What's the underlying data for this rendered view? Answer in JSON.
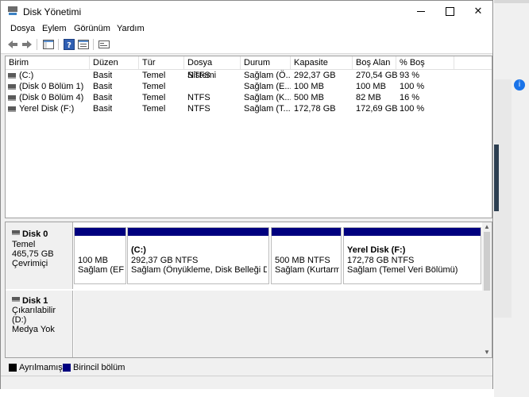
{
  "window": {
    "title": "Disk Yönetimi"
  },
  "menu": [
    "Dosya",
    "Eylem",
    "Görünüm",
    "Yardım"
  ],
  "volume_table": {
    "columns": [
      "Birim",
      "Düzen",
      "Tür",
      "Dosya Sistemi",
      "Durum",
      "Kapasite",
      "Boş Alan",
      "% Boş"
    ],
    "rows": [
      {
        "birim": "(C:)",
        "duzen": "Basit",
        "tur": "Temel",
        "fs": "NTFS",
        "durum": "Sağlam (Ö...",
        "kapasite": "292,37 GB",
        "bos": "270,54 GB",
        "yuzde": "93 %"
      },
      {
        "birim": "(Disk 0 Bölüm 1)",
        "duzen": "Basit",
        "tur": "Temel",
        "fs": "",
        "durum": "Sağlam (E...",
        "kapasite": "100 MB",
        "bos": "100 MB",
        "yuzde": "100 %"
      },
      {
        "birim": "(Disk 0 Bölüm 4)",
        "duzen": "Basit",
        "tur": "Temel",
        "fs": "NTFS",
        "durum": "Sağlam (K...",
        "kapasite": "500 MB",
        "bos": "82 MB",
        "yuzde": "16 %"
      },
      {
        "birim": "Yerel Disk (F:)",
        "duzen": "Basit",
        "tur": "Temel",
        "fs": "NTFS",
        "durum": "Sağlam (T...",
        "kapasite": "172,78 GB",
        "bos": "172,69 GB",
        "yuzde": "100 %"
      }
    ]
  },
  "disks": [
    {
      "name": "Disk 0",
      "lines": [
        "Temel",
        "465,75 GB",
        "Çevrimiçi"
      ],
      "partitions": [
        {
          "title": "",
          "size": "100 MB",
          "status": "Sağlam (EFI"
        },
        {
          "title": "(C:)",
          "size": "292,37 GB NTFS",
          "status": "Sağlam (Önyükleme, Disk Belleği Dosya"
        },
        {
          "title": "",
          "size": "500 MB NTFS",
          "status": "Sağlam (Kurtarma"
        },
        {
          "title": "Yerel Disk  (F:)",
          "size": "172,78 GB NTFS",
          "status": "Sağlam (Temel Veri Bölümü)"
        }
      ]
    },
    {
      "name": "Disk 1",
      "lines": [
        "Çıkarılabilir (D:)",
        "",
        "Medya Yok"
      ]
    }
  ],
  "legend": [
    {
      "label": "Ayrılmamış",
      "color": "#000000"
    },
    {
      "label": "Birincil bölüm",
      "color": "#00007f"
    }
  ]
}
